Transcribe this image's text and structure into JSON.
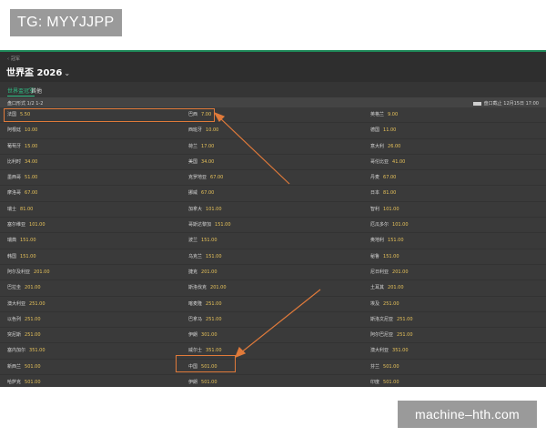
{
  "tg_badge": "TG: MYYJJPP",
  "header": {
    "breadcrumb": "冠军",
    "title": "世界盃 2026"
  },
  "tabs": [
    {
      "label": "世界盃冠军"
    },
    {
      "label": "其他"
    }
  ],
  "market": {
    "title": "盘口形式 1/2 1-2",
    "date": "盘口截止 12月15日 17:00"
  },
  "rows": [
    [
      {
        "team": "法国",
        "odds": "5.50"
      },
      {
        "team": "巴西",
        "odds": "7.00"
      },
      {
        "team": "英格兰",
        "odds": "9.00"
      }
    ],
    [
      {
        "team": "阿根廷",
        "odds": "10.00"
      },
      {
        "team": "西班牙",
        "odds": "10.00"
      },
      {
        "team": "德国",
        "odds": "11.00"
      }
    ],
    [
      {
        "team": "葡萄牙",
        "odds": "15.00"
      },
      {
        "team": "荷兰",
        "odds": "17.00"
      },
      {
        "team": "意大利",
        "odds": "26.00"
      }
    ],
    [
      {
        "team": "比利时",
        "odds": "34.00"
      },
      {
        "team": "美国",
        "odds": "34.00"
      },
      {
        "team": "哥伦比亚",
        "odds": "41.00"
      }
    ],
    [
      {
        "team": "墨西哥",
        "odds": "51.00"
      },
      {
        "team": "克罗地亚",
        "odds": "67.00"
      },
      {
        "team": "丹麦",
        "odds": "67.00"
      }
    ],
    [
      {
        "team": "摩洛哥",
        "odds": "67.00"
      },
      {
        "team": "挪威",
        "odds": "67.00"
      },
      {
        "team": "日本",
        "odds": "81.00"
      }
    ],
    [
      {
        "team": "瑞士",
        "odds": "81.00"
      },
      {
        "team": "加拿大",
        "odds": "101.00"
      },
      {
        "team": "智利",
        "odds": "101.00"
      }
    ],
    [
      {
        "team": "塞尔维亚",
        "odds": "101.00"
      },
      {
        "team": "哥斯达黎加",
        "odds": "151.00"
      },
      {
        "team": "厄瓜多尔",
        "odds": "101.00"
      }
    ],
    [
      {
        "team": "瑞典",
        "odds": "151.00"
      },
      {
        "team": "波兰",
        "odds": "151.00"
      },
      {
        "team": "奥地利",
        "odds": "151.00"
      }
    ],
    [
      {
        "team": "韩国",
        "odds": "151.00"
      },
      {
        "team": "乌克兰",
        "odds": "151.00"
      },
      {
        "team": "秘鲁",
        "odds": "151.00"
      }
    ],
    [
      {
        "team": "阿尔及利亚",
        "odds": "201.00"
      },
      {
        "team": "捷克",
        "odds": "201.00"
      },
      {
        "team": "尼日利亚",
        "odds": "201.00"
      }
    ],
    [
      {
        "team": "巴拉圭",
        "odds": "201.00"
      },
      {
        "team": "斯洛伐克",
        "odds": "201.00"
      },
      {
        "team": "土耳其",
        "odds": "201.00"
      }
    ],
    [
      {
        "team": "澳大利亚",
        "odds": "251.00"
      },
      {
        "team": "喀麦隆",
        "odds": "251.00"
      },
      {
        "team": "埃及",
        "odds": "251.00"
      }
    ],
    [
      {
        "team": "以色列",
        "odds": "251.00"
      },
      {
        "team": "巴拿马",
        "odds": "251.00"
      },
      {
        "team": "斯洛文尼亚",
        "odds": "251.00"
      }
    ],
    [
      {
        "team": "突尼斯",
        "odds": "251.00"
      },
      {
        "team": "伊朗",
        "odds": "301.00"
      },
      {
        "team": "阿尔巴尼亚",
        "odds": "251.00"
      }
    ],
    [
      {
        "team": "塞内加尔",
        "odds": "351.00"
      },
      {
        "team": "威尔士",
        "odds": "351.00"
      },
      {
        "team": "澳大利亚",
        "odds": "351.00"
      }
    ],
    [
      {
        "team": "新西兰",
        "odds": "501.00"
      },
      {
        "team": "中国",
        "odds": "501.00"
      },
      {
        "team": "芬兰",
        "odds": "501.00"
      }
    ],
    [
      {
        "team": "哈萨克",
        "odds": "501.00"
      },
      {
        "team": "伊朗",
        "odds": "501.00"
      },
      {
        "team": "印度",
        "odds": "501.00"
      }
    ]
  ],
  "watermark": "machine–hth.com",
  "colors": {
    "accent": "#2fbf85",
    "odds": "#e6c15a",
    "highlight": "#e07a3a",
    "background": "#3a3a3a"
  }
}
